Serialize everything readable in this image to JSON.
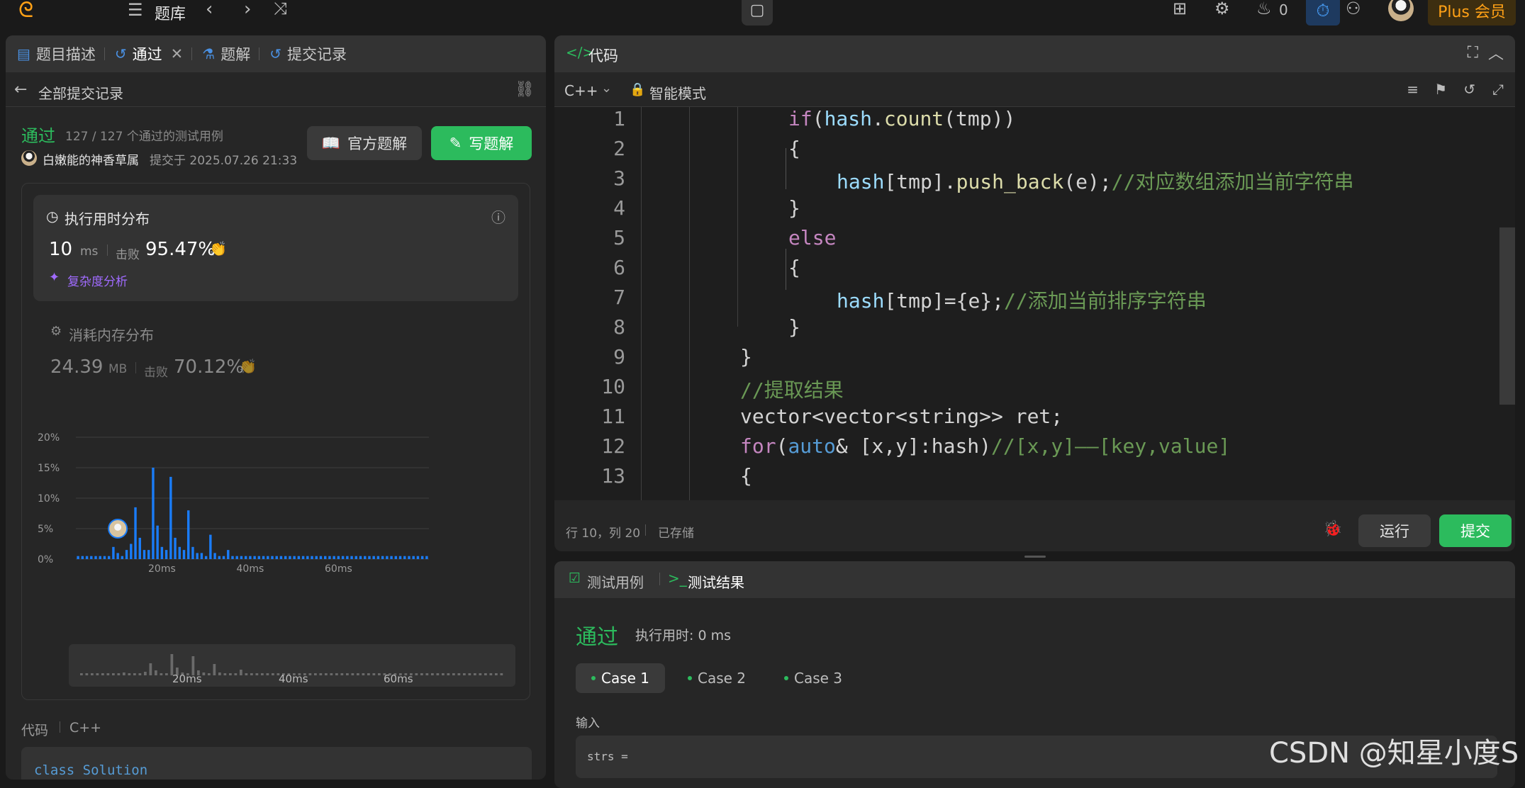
{
  "topbar": {
    "nav_label": "题库",
    "streak_count": "0",
    "plus_label": "Plus 会员"
  },
  "left_panel": {
    "tabs": [
      {
        "label": "题目描述",
        "icon": "description-icon"
      },
      {
        "label": "通过",
        "icon": "history-icon"
      },
      {
        "label": "题解",
        "icon": "flask-icon"
      },
      {
        "label": "提交记录",
        "icon": "history-icon"
      }
    ],
    "back_label": "全部提交记录",
    "status": "通过",
    "testcases": "127 / 127 个通过的测试用例",
    "user": "白嫩能的神香草属",
    "submitted_at": "提交于 2025.07.26 21:33",
    "official_solution_label": "官方题解",
    "write_solution_label": "写题解",
    "runtime": {
      "title": "执行用时分布",
      "value": "10",
      "unit": "ms",
      "beats_label": "击败",
      "beats": "95.47%",
      "complexity_label": "复杂度分析"
    },
    "memory": {
      "title": "消耗内存分布",
      "value": "24.39",
      "unit": "MB",
      "beats_label": "击败",
      "beats": "70.12%"
    },
    "code_label": "代码",
    "language": "C++",
    "code_preview": "class Solution"
  },
  "chart_data": {
    "type": "bar",
    "title": "执行用时分布",
    "xlabel": "",
    "ylabel": "",
    "ylim": [
      0,
      20
    ],
    "y_ticks": [
      "0%",
      "5%",
      "10%",
      "15%",
      "20%"
    ],
    "x_ticks": [
      "20ms",
      "40ms",
      "60ms"
    ],
    "x": [
      1,
      2,
      3,
      4,
      5,
      6,
      7,
      8,
      9,
      10,
      11,
      12,
      13,
      14,
      15,
      16,
      17,
      18,
      19,
      20,
      21,
      22,
      23,
      24,
      25,
      26,
      27,
      28,
      29,
      30,
      31,
      32,
      33,
      34,
      35,
      36,
      37,
      38,
      39,
      40,
      41,
      42,
      43,
      44,
      45,
      46,
      47,
      48,
      49,
      50,
      51,
      52,
      53,
      54,
      55,
      56,
      57,
      58,
      59,
      60,
      61,
      62,
      63,
      64,
      65,
      66,
      67,
      68,
      69,
      70,
      71,
      72,
      73,
      74,
      75,
      76,
      77,
      78,
      79,
      80
    ],
    "values": [
      0.5,
      0.5,
      0.5,
      0.5,
      0.5,
      0.5,
      0.5,
      0.5,
      2.0,
      1.0,
      0.5,
      1.5,
      2.5,
      8.5,
      3.5,
      1.5,
      1.5,
      15.0,
      5.5,
      2.0,
      1.5,
      13.5,
      3.5,
      2.0,
      1.5,
      8.0,
      2.0,
      1.0,
      1.0,
      0.5,
      4.0,
      1.0,
      0.5,
      0.5,
      1.5,
      0.5,
      0.5,
      0.5,
      0.5,
      0.5,
      0.5,
      0.5,
      0.5,
      0.5,
      0.5,
      0.5,
      0.5,
      0.5,
      0.5,
      0.5,
      0.5,
      0.5,
      0.5,
      0.5,
      0.5,
      0.5,
      0.5,
      0.5,
      0.5,
      0.5,
      0.5,
      0.5,
      0.5,
      0.5,
      0.5,
      0.5,
      0.5,
      0.5,
      0.5,
      0.5,
      0.5,
      0.5,
      0.5,
      0.5,
      0.5,
      0.5,
      0.5,
      0.5,
      0.5,
      0.5
    ],
    "highlight_x": 10,
    "grid": true,
    "bar_color": "#1a7cf7"
  },
  "editor": {
    "title": "代码",
    "language": "C++",
    "mode": "智能模式",
    "line_numbers": [
      "1",
      "2",
      "3",
      "4",
      "5",
      "6",
      "7",
      "8",
      "9",
      "10",
      "11",
      "12",
      "13"
    ],
    "cursor": "行 10，列 20",
    "saved": "已存储",
    "run_label": "运行",
    "submit_label": "提交"
  },
  "result": {
    "tabs": [
      "测试用例",
      "测试结果"
    ],
    "status": "通过",
    "runtime": "执行用时: 0 ms",
    "cases": [
      "Case 1",
      "Case 2",
      "Case 3"
    ],
    "input_label": "输入",
    "input_var": "strs ="
  },
  "watermark": "CSDN @知星小度S",
  "colors": {
    "accent_green": "#2cbb5d",
    "accent_blue": "#1a7cf7",
    "plus_orange": "#ffa116"
  }
}
